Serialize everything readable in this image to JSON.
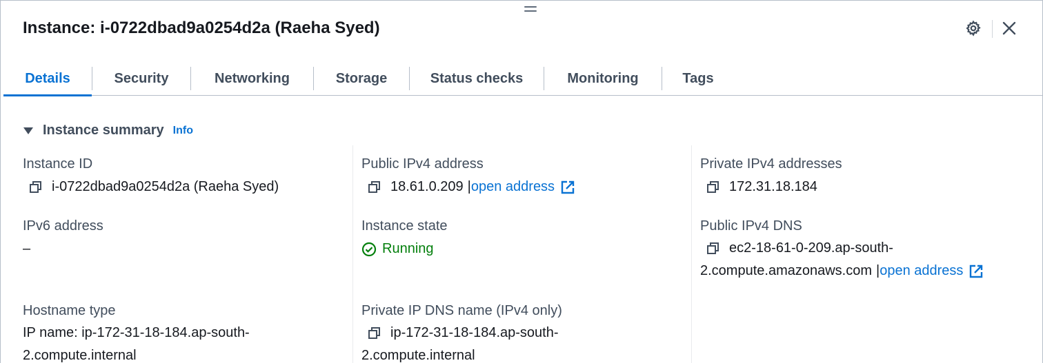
{
  "header": {
    "title": "Instance: i-0722dbad9a0254d2a (Raeha Syed)"
  },
  "tabs": [
    {
      "label": "Details",
      "active": true
    },
    {
      "label": "Security",
      "active": false
    },
    {
      "label": "Networking",
      "active": false
    },
    {
      "label": "Storage",
      "active": false
    },
    {
      "label": "Status checks",
      "active": false
    },
    {
      "label": "Monitoring",
      "active": false
    },
    {
      "label": "Tags",
      "active": false
    }
  ],
  "section": {
    "title": "Instance summary",
    "info_label": "Info"
  },
  "fields": {
    "instance_id": {
      "label": "Instance ID",
      "value": "i-0722dbad9a0254d2a (Raeha Syed)"
    },
    "public_ipv4": {
      "label": "Public IPv4 address",
      "value": "18.61.0.209",
      "sep": "|",
      "link": "open address"
    },
    "private_ipv4": {
      "label": "Private IPv4 addresses",
      "value": "172.31.18.184"
    },
    "ipv6": {
      "label": "IPv6 address",
      "value": "–"
    },
    "instance_state": {
      "label": "Instance state",
      "value": "Running"
    },
    "public_dns": {
      "label": "Public IPv4 DNS",
      "value_line1": "ec2-18-61-0-209.ap-south-",
      "value_line2": "2.compute.amazonaws.com",
      "sep": "|",
      "link": "open address"
    },
    "hostname_type": {
      "label": "Hostname type",
      "value_line1": "IP name: ip-172-31-18-184.ap-south-",
      "value_line2": "2.compute.internal"
    },
    "private_dns": {
      "label": "Private IP DNS name (IPv4 only)",
      "value_line1": "ip-172-31-18-184.ap-south-",
      "value_line2": "2.compute.internal"
    }
  },
  "colors": {
    "accent": "#0972d3",
    "success": "#037f0c",
    "text": "#16191f",
    "muted": "#414d5c"
  },
  "icons": {
    "gear": "gear-icon",
    "close": "close-icon",
    "copy": "copy-icon",
    "external": "external-link-icon",
    "status_ok": "check-circle-icon",
    "caret": "caret-down-icon",
    "drag": "drag-handle-icon"
  }
}
